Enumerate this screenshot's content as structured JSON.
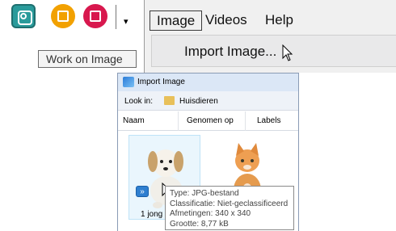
{
  "toolbar": {
    "buttons": [
      {
        "icon": "camera-icon",
        "color": "#2a9b9b"
      },
      {
        "icon": "edit-icon",
        "color": "#f2a100"
      },
      {
        "icon": "film-icon",
        "color": "#d8184e"
      }
    ],
    "dropdown_arrow": "▾",
    "tooltip": "Work on Image"
  },
  "menu": {
    "items": [
      "Image",
      "Videos",
      "Help"
    ],
    "active": "Image",
    "dropdown": {
      "item": "Import Image..."
    }
  },
  "dialog": {
    "title": "Import Image",
    "look_in_label": "Look in:",
    "folder": "Huisdieren",
    "columns": [
      "Naam",
      "Genomen op",
      "Labels"
    ],
    "files": [
      {
        "name": "1 jong",
        "selected": true
      },
      {
        "name": "",
        "selected": false
      }
    ],
    "tooltip_lines": [
      "Type: JPG-bestand",
      "Classificatie: Niet-geclassificeerd",
      "Afmetingen: 340 x 340",
      "Grootte: 8,77 kB"
    ],
    "expand_glyph": "»"
  }
}
